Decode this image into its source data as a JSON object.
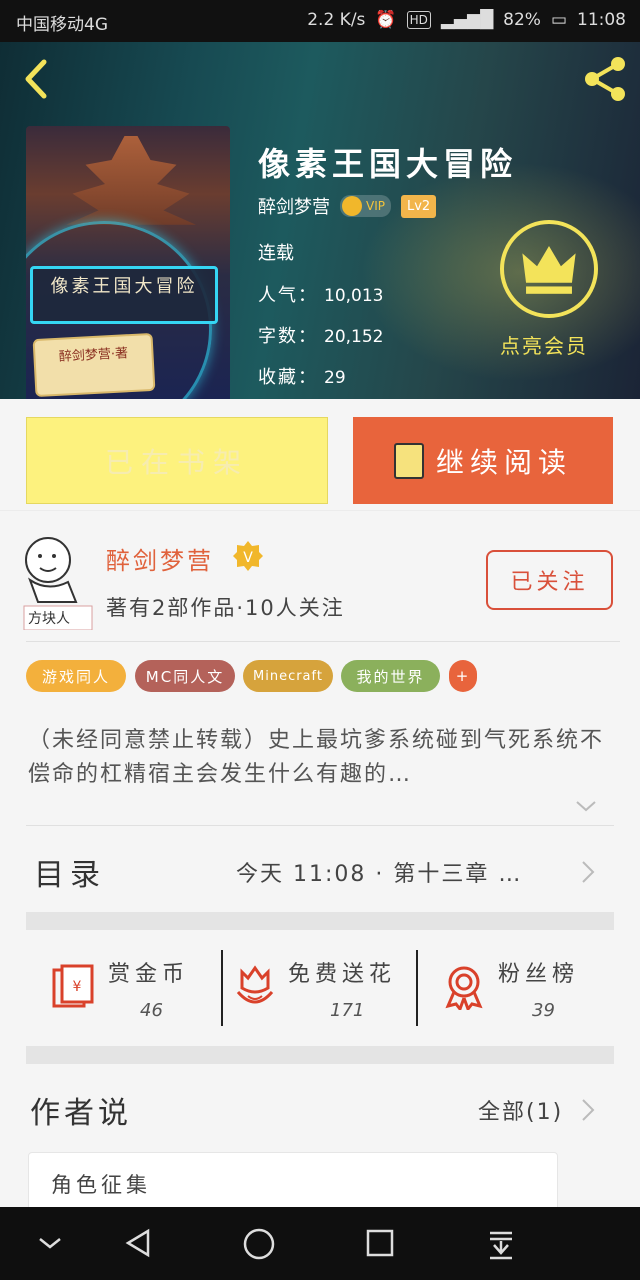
{
  "status_bar": {
    "carrier": "中国移动4G",
    "speed": "2.2 K/s",
    "hd": "HD",
    "battery": "82%",
    "time": "11:08"
  },
  "book": {
    "title": "像素王国大冒险",
    "author": "醉剑梦营",
    "vip_label": "VIP",
    "level": "Lv2",
    "status": "连载",
    "popularity_label": "人气：",
    "popularity": "10,013",
    "words_label": "字数：",
    "words": "20,152",
    "favorites_label": "收藏：",
    "favorites": "29",
    "cover_title": "像素王国大冒险",
    "cover_author": "醉剑梦营·著"
  },
  "vip_member_label": "点亮会员",
  "actions": {
    "shelf_label": "已在书架",
    "read_label": "继续阅读"
  },
  "author": {
    "name": "醉剑梦营",
    "avatar_caption": "方块人",
    "stats": "著有2部作品·10人关注",
    "follow_label": "已关注"
  },
  "tags": [
    "游戏同人",
    "MC同人文",
    "Minecraft",
    "我的世界",
    "+"
  ],
  "description": "（未经同意禁止转载）史上最坑爹系统碰到气死系统不偿命的杠精宿主会发生什么有趣的…",
  "toc": {
    "label": "目录",
    "latest": "今天 11:08 · 第十三章 …"
  },
  "rewards": [
    {
      "label": "赏金币",
      "count": "46",
      "icon": "red-envelope-icon"
    },
    {
      "label": "免费送花",
      "count": "171",
      "icon": "flower-icon"
    },
    {
      "label": "粉丝榜",
      "count": "39",
      "icon": "medal-icon"
    }
  ],
  "author_says": {
    "title": "作者说",
    "all_label": "全部(1)",
    "first_post": "角色征集"
  },
  "colors": {
    "accent": "#e8643c",
    "shelf_button": "#fdf27e",
    "author_name": "#e0623c",
    "vip_gold": "#f3e35a"
  }
}
